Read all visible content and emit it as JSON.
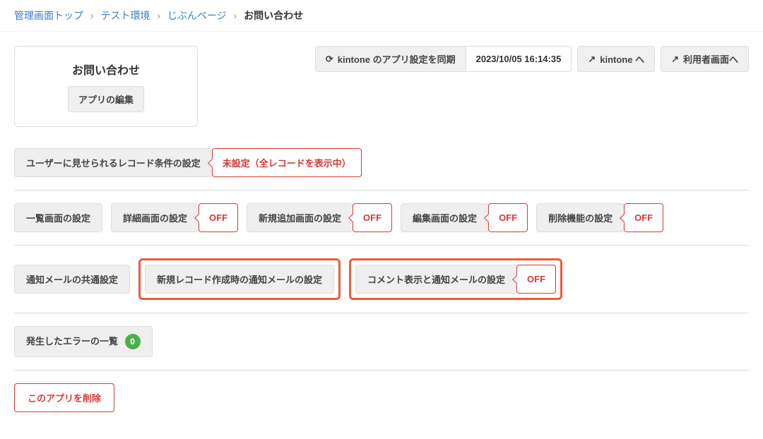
{
  "breadcrumb": {
    "items": [
      {
        "label": "管理画面トップ"
      },
      {
        "label": "テスト環境"
      },
      {
        "label": "じぶんページ"
      }
    ],
    "current": "お問い合わせ"
  },
  "app": {
    "title": "お問い合わせ",
    "edit_label": "アプリの編集"
  },
  "top_actions": {
    "sync_label": "kintone のアプリ設定を同期",
    "sync_time": "2023/10/05 16:14:35",
    "to_kintone": "kintone へ",
    "to_user_page": "利用者画面へ"
  },
  "sections": {
    "record_condition": {
      "label": "ユーザーに見せられるレコード条件の設定",
      "status": "未設定（全レコードを表示中）"
    },
    "screens": {
      "list": {
        "label": "一覧画面の設定"
      },
      "detail": {
        "label": "詳細画面の設定",
        "status": "OFF"
      },
      "create": {
        "label": "新規追加画面の設定",
        "status": "OFF"
      },
      "edit": {
        "label": "編集画面の設定",
        "status": "OFF"
      },
      "delete": {
        "label": "削除機能の設定",
        "status": "OFF"
      }
    },
    "mail": {
      "common": {
        "label": "通知メールの共通設定"
      },
      "new_record": {
        "label": "新規レコード作成時の通知メールの設定"
      },
      "comment": {
        "label": "コメント表示と通知メールの設定",
        "status": "OFF"
      }
    },
    "errors": {
      "label": "発生したエラーの一覧",
      "count": "0"
    },
    "delete_app": {
      "label": "このアプリを削除"
    }
  },
  "icons": {
    "sync": "⟳",
    "external": "↗",
    "chevron": "›"
  }
}
